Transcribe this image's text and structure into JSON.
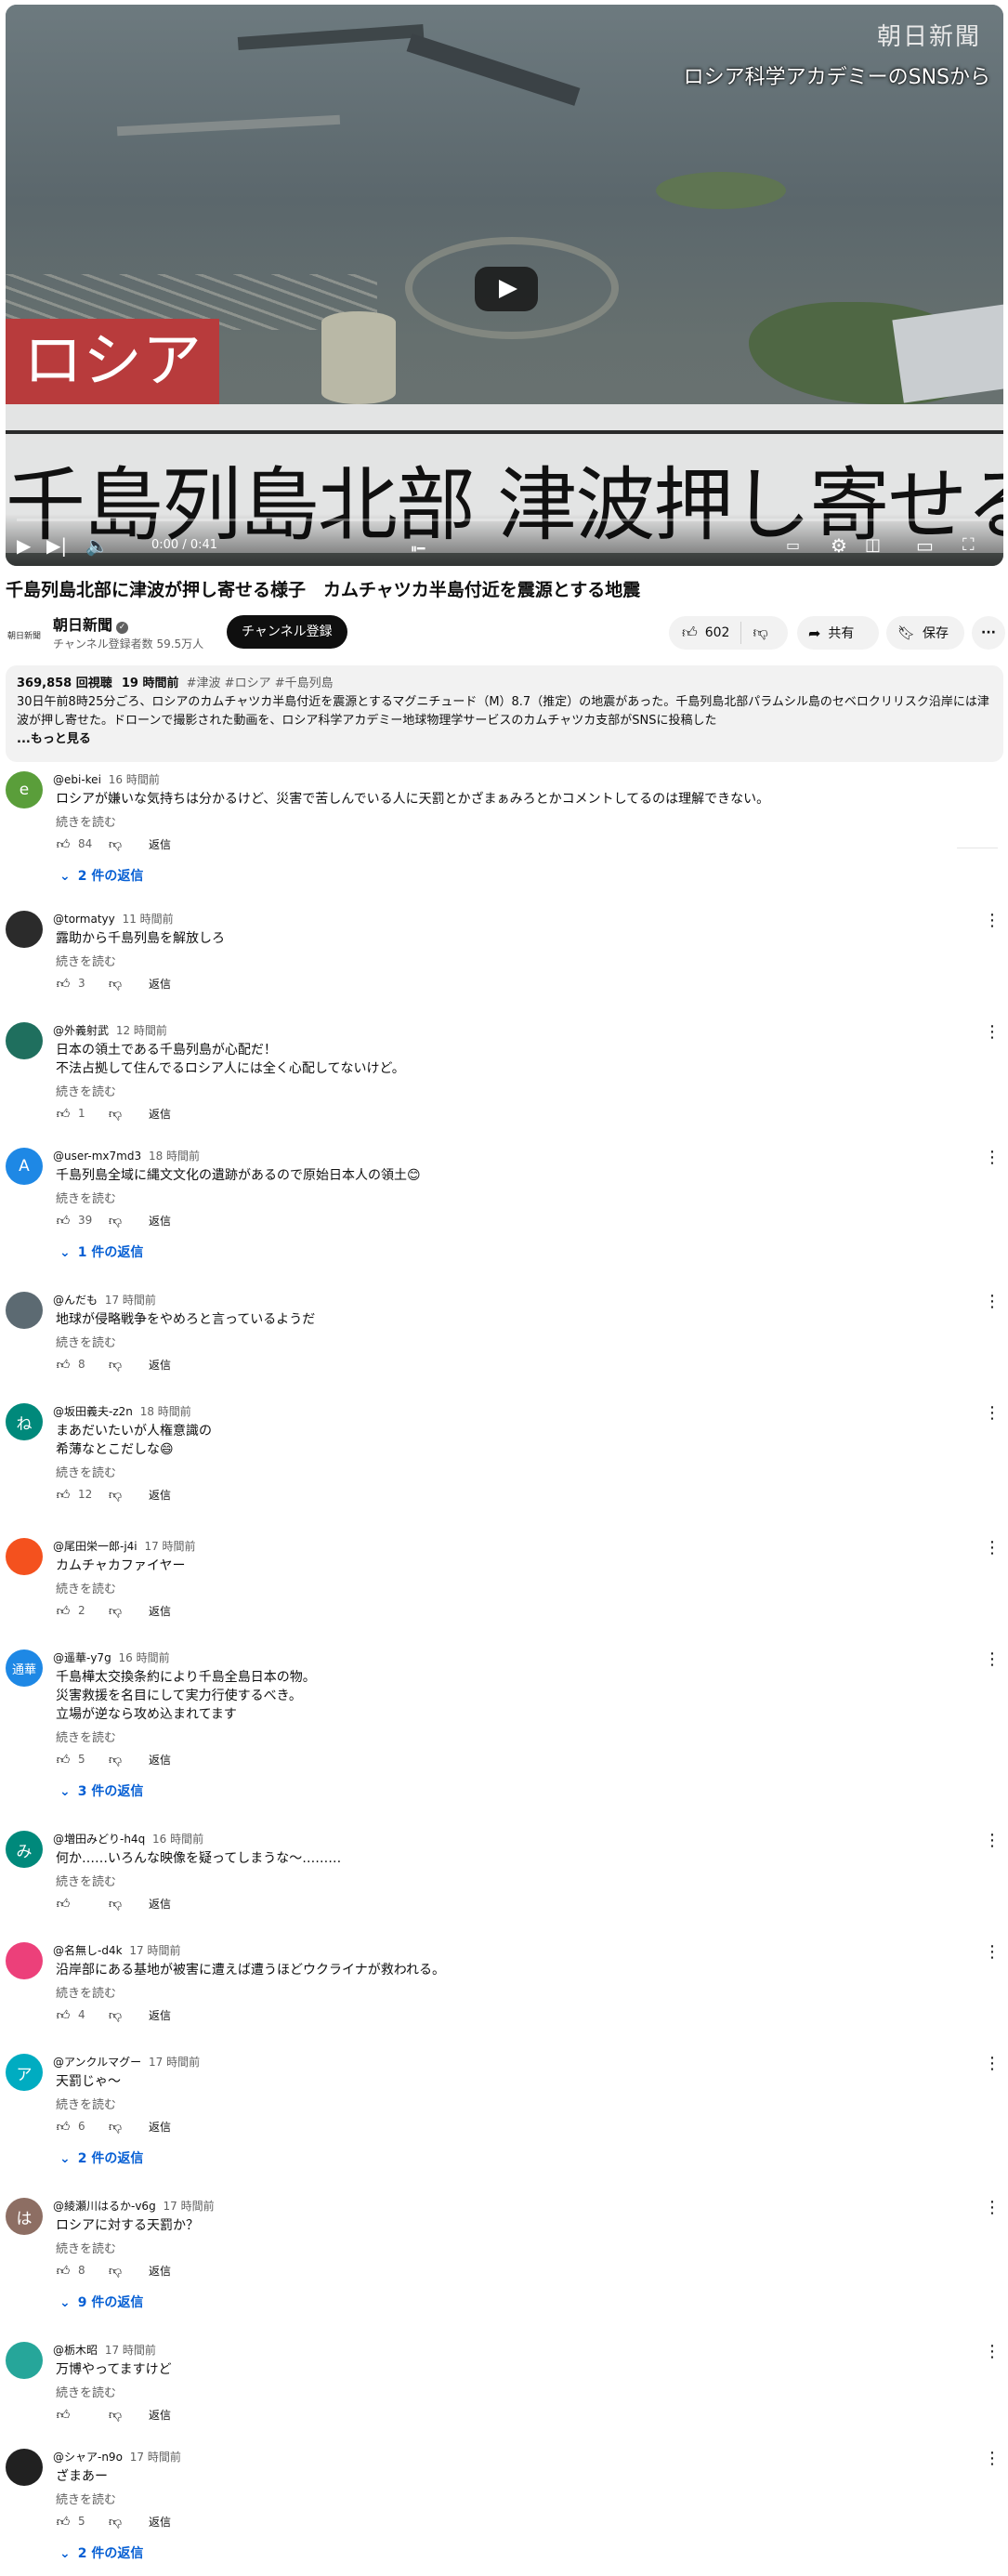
{
  "video": {
    "watermark": "朝日新聞",
    "source_caption": "ロシア科学アカデミーのSNSから",
    "red_tag": "ロシア",
    "headline_overlay": "千島列島北部 津波押し寄せる",
    "time": "0:00 / 0:41"
  },
  "title": "千島列島北部に津波が押し寄せる様子　カムチャツカ半島付近を震源とする地震",
  "channel": {
    "logo_text": "朝日新聞",
    "name": "朝日新聞",
    "subscribers": "チャンネル登録者数 59.5万人",
    "subscribe_label": "チャンネル登録"
  },
  "actions": {
    "likes": "602",
    "share_label": "共有",
    "save_label": "保存"
  },
  "description": {
    "views": "369,858 回視聴",
    "age": "19 時間前",
    "tags": "#津波 #ロシア #千島列島",
    "text": "30日午前8時25分ごろ、ロシアのカムチャツカ半島付近を震源とするマグニチュード（M）8.7（推定）の地震があった。千島列島北部パラムシル島のセベロクリリスク沿岸には津波が押し寄せた。ドローンで撮影された動画を、ロシア科学アカデミー地球物理学サービスのカムチャツカ支部がSNSに投稿した",
    "more": "...もっと見る"
  },
  "labels": {
    "read_more": "続きを読む",
    "reply": "返信"
  },
  "comments": [
    {
      "avatar": "e",
      "color": "#5a9e3a",
      "author": "@ebi-kei",
      "time": "16 時間前",
      "text": "ロシアが嫌いな気持ちは分かるけど、災害で苦しんでいる人に天罰とかざまぁみろとかコメントしてるのは理解できない。",
      "likes": "84",
      "replies": "2 件の返信"
    },
    {
      "avatar": "",
      "color": "#2b2b2b",
      "author": "@tormatyy",
      "time": "11 時間前",
      "text": "露助から千島列島を解放しろ",
      "likes": "3",
      "replies": ""
    },
    {
      "avatar": "",
      "color": "#1f6f5e",
      "author": "@外義射武",
      "time": "12 時間前",
      "text": "日本の領土である千島列島が心配だ！\n不法占拠して住んでるロシア人には全く心配してないけど。",
      "likes": "1",
      "replies": ""
    },
    {
      "avatar": "A",
      "color": "#1e88e5",
      "author": "@user-mx7md3",
      "time": "18 時間前",
      "text": "千島列島全域に縄文文化の遺跡があるので原始日本人の領土😊",
      "likes": "39",
      "replies": "1 件の返信"
    },
    {
      "avatar": "",
      "color": "#5c6a72",
      "author": "@んだも",
      "time": "17 時間前",
      "text": "地球が侵略戦争をやめろと言っているようだ",
      "likes": "8",
      "replies": ""
    },
    {
      "avatar": "ね",
      "color": "#00897b",
      "author": "@坂田義夫-z2n",
      "time": "18 時間前",
      "text": "まあだいたいが人権意識の\n希薄なとこだしな😄",
      "likes": "12",
      "replies": ""
    },
    {
      "avatar": "",
      "color": "#f4511e",
      "author": "@尾田栄一郎-j4i",
      "time": "17 時間前",
      "text": "カムチャカファイヤー",
      "likes": "2",
      "replies": ""
    },
    {
      "avatar": "通華",
      "color": "#1e88e5",
      "author": "@遥華-y7g",
      "time": "16 時間前",
      "text": "千島樺太交換条約により千島全島日本の物。\n災害救援を名目にして実力行使するべき。\n立場が逆なら攻め込まれてます",
      "likes": "5",
      "replies": "3 件の返信"
    },
    {
      "avatar": "み",
      "color": "#00897b",
      "author": "@増田みどり-h4q",
      "time": "16 時間前",
      "text": "何か……いろんな映像を疑ってしまうな〜………",
      "likes": "",
      "replies": ""
    },
    {
      "avatar": "",
      "color": "#ec407a",
      "author": "@名無し-d4k",
      "time": "17 時間前",
      "text": "沿岸部にある基地が被害に遭えば遭うほどウクライナが救われる。",
      "likes": "4",
      "replies": ""
    },
    {
      "avatar": "ア",
      "color": "#00acc1",
      "author": "@アンクルマグー",
      "time": "17 時間前",
      "text": "天罰じゃ〜",
      "likes": "6",
      "replies": "2 件の返信"
    },
    {
      "avatar": "は",
      "color": "#8d6e63",
      "author": "@綾瀬川はるか-v6g",
      "time": "17 時間前",
      "text": "ロシアに対する天罰か？",
      "likes": "8",
      "replies": "9 件の返信"
    },
    {
      "avatar": "",
      "color": "#26a69a",
      "author": "@栃木昭",
      "time": "17 時間前",
      "text": "万博やってますけど",
      "likes": "",
      "replies": ""
    },
    {
      "avatar": "",
      "color": "#212121",
      "author": "@シャア-n9o",
      "time": "17 時間前",
      "text": "ざまあー",
      "likes": "5",
      "replies": "2 件の返信"
    }
  ]
}
